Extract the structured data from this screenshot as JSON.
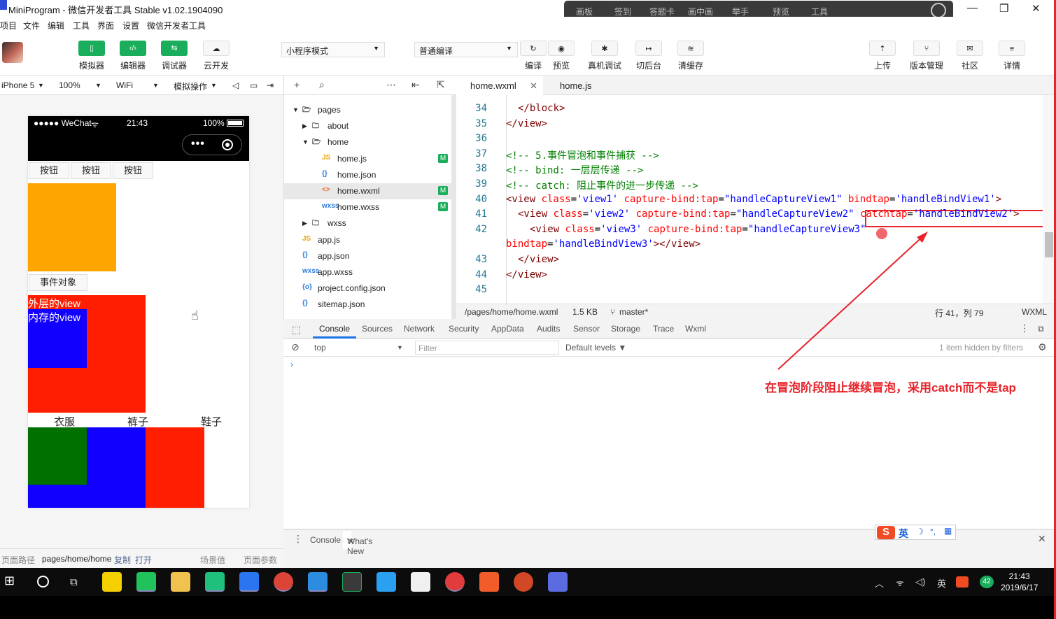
{
  "window": {
    "title": "MiniProgram - 微信开发者工具 Stable v1.02.1904090",
    "overlay_menu": [
      "画板",
      "签到",
      "答题卡",
      "画中画",
      "举手",
      "预览",
      "工具"
    ]
  },
  "menubar": [
    "项目",
    "文件",
    "编辑",
    "工具",
    "界面",
    "设置",
    "微信开发者工具"
  ],
  "toolbar": {
    "left_buttons": [
      "模拟器",
      "编辑器",
      "调试器",
      "云开发"
    ],
    "mode_select": "小程序模式",
    "compile_select": "普通编译",
    "mid_buttons": [
      "编译",
      "预览",
      "真机调试",
      "切后台",
      "清缓存"
    ],
    "right_buttons": [
      "上传",
      "版本管理",
      "社区",
      "详情"
    ]
  },
  "simulator": {
    "device": "iPhone 5",
    "zoom": "100%",
    "network": "WiFi",
    "sim_ops": "模拟操作",
    "status_left": "●●●●● WeChat",
    "status_time": "21:43",
    "status_battery": "100%",
    "buttons": [
      "按钮",
      "按钮",
      "按钮"
    ],
    "event_button": "事件对象",
    "outer_view": "外层的view",
    "inner_view": "内存的view",
    "tabs": [
      "衣服",
      "裤子",
      "鞋子"
    ],
    "colors": {
      "orange": "#ffa500",
      "red": "#ff1f00",
      "blue": "#1200ff",
      "green": "#007000"
    }
  },
  "bottom_bar": {
    "path_label": "页面路径",
    "path": "pages/home/home",
    "copy": "复制",
    "open": "打开",
    "scene": "场景值",
    "params": "页面参数"
  },
  "file_tree": [
    {
      "name": "pages",
      "type": "folder-open",
      "indent": 0
    },
    {
      "name": "about",
      "type": "folder",
      "indent": 1
    },
    {
      "name": "home",
      "type": "folder-open",
      "indent": 1
    },
    {
      "name": "home.js",
      "type": "js",
      "indent": 2,
      "badge": "M"
    },
    {
      "name": "home.json",
      "type": "json",
      "indent": 2
    },
    {
      "name": "home.wxml",
      "type": "wxml",
      "indent": 2,
      "badge": "M",
      "active": true
    },
    {
      "name": "home.wxss",
      "type": "wxss",
      "indent": 2,
      "badge": "M"
    },
    {
      "name": "wxss",
      "type": "folder",
      "indent": 1
    },
    {
      "name": "app.js",
      "type": "js",
      "indent": 0
    },
    {
      "name": "app.json",
      "type": "json",
      "indent": 0
    },
    {
      "name": "app.wxss",
      "type": "wxss",
      "indent": 0
    },
    {
      "name": "project.config.json",
      "type": "config",
      "indent": 0
    },
    {
      "name": "sitemap.json",
      "type": "json",
      "indent": 0
    }
  ],
  "editor": {
    "tabs": [
      "home.wxml",
      "home.js"
    ],
    "lines": [
      {
        "n": "34",
        "indent": 1,
        "parts": [
          [
            "tag",
            "</block>"
          ]
        ]
      },
      {
        "n": "35",
        "indent": 0,
        "parts": [
          [
            "tag",
            "</view>"
          ]
        ]
      },
      {
        "n": "36",
        "indent": 0,
        "parts": []
      },
      {
        "n": "37",
        "indent": 0,
        "parts": [
          [
            "com",
            "<!-- 5.事件冒泡和事件捕获 -->"
          ]
        ]
      },
      {
        "n": "38",
        "indent": 0,
        "parts": [
          [
            "com",
            "<!-- bind: 一层层传递 -->"
          ]
        ]
      },
      {
        "n": "39",
        "indent": 0,
        "parts": [
          [
            "com",
            "<!-- catch: 阻止事件的进一步传递 -->"
          ]
        ]
      },
      {
        "n": "40",
        "indent": 0,
        "parts": [
          [
            "tag",
            "<view "
          ],
          [
            "att",
            "class"
          ],
          [
            "txt",
            "="
          ],
          [
            "str",
            "'view1'"
          ],
          [
            "txt",
            " "
          ],
          [
            "att",
            "capture-bind:tap"
          ],
          [
            "txt",
            "="
          ],
          [
            "str",
            "\"handleCaptureView1\""
          ],
          [
            "txt",
            " "
          ],
          [
            "att",
            "bindtap"
          ],
          [
            "txt",
            "="
          ],
          [
            "str",
            "'handleBindView1'"
          ],
          [
            "tag",
            ">"
          ]
        ]
      },
      {
        "n": "41",
        "indent": 1,
        "parts": [
          [
            "tag",
            "<view "
          ],
          [
            "att",
            "class"
          ],
          [
            "txt",
            "="
          ],
          [
            "str",
            "'view2'"
          ],
          [
            "txt",
            " "
          ],
          [
            "att",
            "capture-bind:tap"
          ],
          [
            "txt",
            "="
          ],
          [
            "str",
            "\"handleCaptureView2\""
          ],
          [
            "txt",
            " "
          ],
          [
            "att",
            "catchtap"
          ],
          [
            "txt",
            "="
          ],
          [
            "str",
            "'handleBindView2'"
          ],
          [
            "tag",
            ">"
          ]
        ]
      },
      {
        "n": "42",
        "indent": 2,
        "parts": [
          [
            "tag",
            "<view "
          ],
          [
            "att",
            "class"
          ],
          [
            "txt",
            "="
          ],
          [
            "str",
            "'view3'"
          ],
          [
            "txt",
            " "
          ],
          [
            "att",
            "capture-bind:tap"
          ],
          [
            "txt",
            "="
          ],
          [
            "str",
            "\"handleCaptureView3\""
          ]
        ]
      },
      {
        "n": "",
        "indent": 0,
        "parts": [
          [
            "att",
            "bindtap"
          ],
          [
            "txt",
            "="
          ],
          [
            "str",
            "'handleBindView3'"
          ],
          [
            "tag",
            "></view>"
          ]
        ]
      },
      {
        "n": "43",
        "indent": 1,
        "parts": [
          [
            "tag",
            "</view>"
          ]
        ]
      },
      {
        "n": "44",
        "indent": 0,
        "parts": [
          [
            "tag",
            "</view>"
          ]
        ]
      },
      {
        "n": "45",
        "indent": 0,
        "parts": []
      }
    ],
    "status": {
      "path": "/pages/home/home.wxml",
      "size": "1.5 KB",
      "branch": "master*",
      "position": "行 41，列 79",
      "lang": "WXML"
    }
  },
  "devtools": {
    "tabs": [
      "Console",
      "Sources",
      "Network",
      "Security",
      "AppData",
      "Audits",
      "Sensor",
      "Storage",
      "Trace",
      "Wxml"
    ],
    "context": "top",
    "filter_placeholder": "Filter",
    "levels": "Default levels ▼",
    "hidden_note": "1 item hidden by filters",
    "drawer_tabs": [
      "Console",
      "What's New"
    ]
  },
  "annotation": "在冒泡阶段阻止继续冒泡，采用catch而不是tap",
  "ime": {
    "lang": "英"
  },
  "taskbar": {
    "time": "21:43",
    "date": "2019/6/17",
    "lang": "英",
    "badge": "42"
  }
}
